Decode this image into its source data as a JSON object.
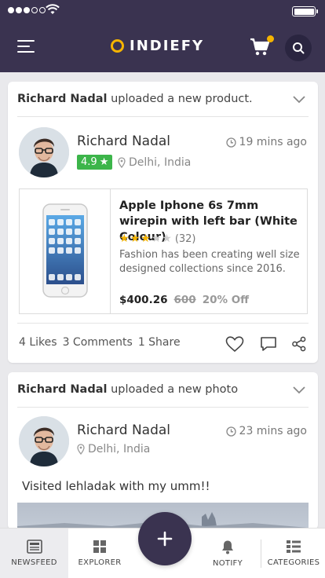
{
  "brand": {
    "name": "INDIEFY",
    "accent": "#f5b400",
    "primary": "#3a3350"
  },
  "header": {
    "menu_icon": "hamburger-icon",
    "cart_icon": "cart-icon",
    "search_icon": "search-icon"
  },
  "feed": [
    {
      "activity_user": "Richard Nadal",
      "activity_text": "uploaded a new product.",
      "user_name": "Richard Nadal",
      "time": "19 mins ago",
      "rating": "4.9",
      "location": "Delhi, India",
      "product": {
        "title": "Apple Iphone 6s 7mm wirepin with left bar (White Colour)",
        "stars": 3,
        "max_stars": 5,
        "review_count": "(32)",
        "description": "Fashion has been creating well size designed collections since 2016.",
        "price": "$400.26",
        "old_price": "600",
        "discount": "20% Off"
      },
      "stats": {
        "likes": "4 Likes",
        "comments": "3 Comments",
        "shares": "1 Share"
      }
    },
    {
      "activity_user": "Richard Nadal",
      "activity_text": "uploaded a new photo",
      "user_name": "Richard Nadal",
      "time": "23 mins ago",
      "location": "Delhi, India",
      "post_text": "Visited lehladak with my umm!!"
    }
  ],
  "bottom_nav": {
    "items": [
      {
        "label": "NEWSFEED",
        "icon": "newsfeed-icon",
        "active": true
      },
      {
        "label": "EXPLORER",
        "icon": "grid-icon",
        "active": false
      },
      {
        "label": "NOTIFY",
        "icon": "bell-icon",
        "active": false
      },
      {
        "label": "CATEGORIES",
        "icon": "list-icon",
        "active": false
      }
    ],
    "fab_icon": "plus-icon"
  }
}
